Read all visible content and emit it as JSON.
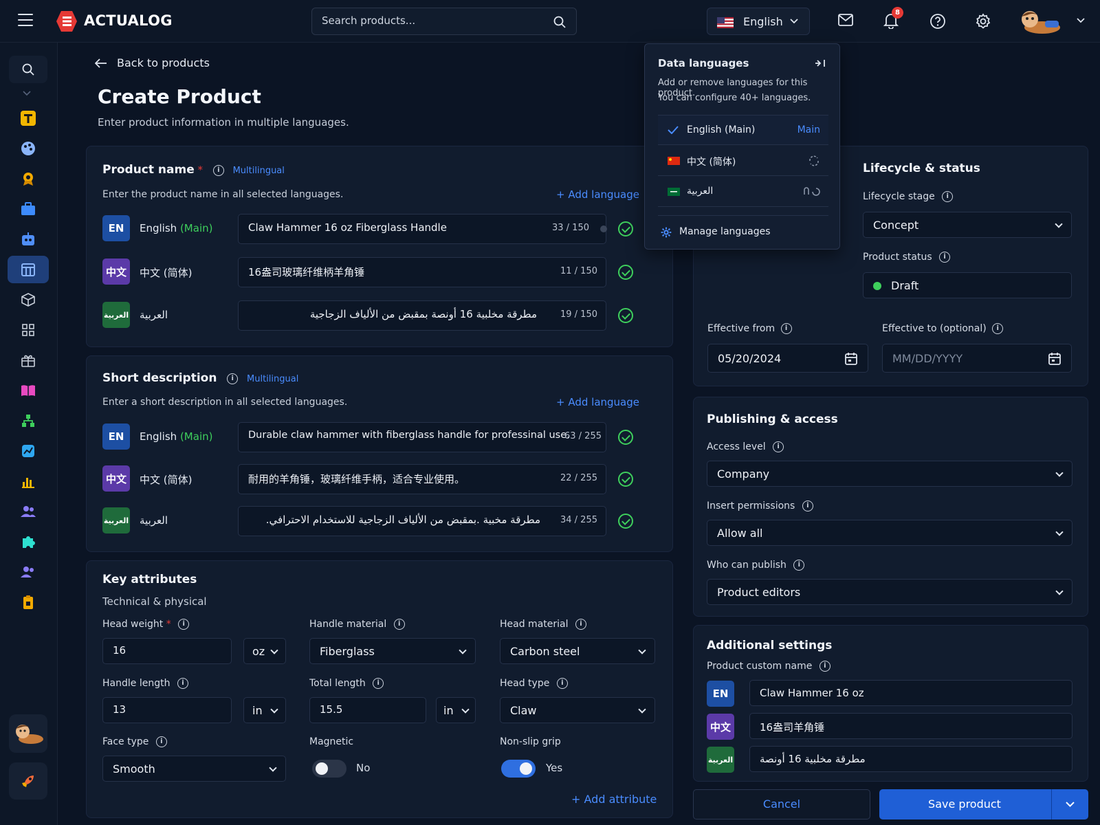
{
  "app": {
    "brand": "ACTUALOG"
  },
  "topbar": {
    "search_placeholder": "Search products...",
    "language": "English",
    "notification_count": "8"
  },
  "page": {
    "back_label": "Back to products",
    "title": "Create Product",
    "subtitle": "Enter product information in multiple languages."
  },
  "product_name": {
    "title": "Product name",
    "required_mark": "*",
    "multilingual": "Multilingual",
    "hint": "Enter the product name in all selected languages.",
    "add_language": "Add language",
    "rows": [
      {
        "tag": "EN",
        "name": "English",
        "main": "(Main)",
        "value": "Claw Hammer 16 oz Fiberglass Handle",
        "count": "33 / 150"
      },
      {
        "tag": "中文",
        "name": "中文 (简体)",
        "main": "",
        "value": "16盎司玻璃纤维柄羊角锤",
        "count": "11 / 150"
      },
      {
        "tag": "العربية",
        "name": "العربية",
        "main": "",
        "value": "مطرقة مخلبية 16 أونصة بمقبض من الألياف الزجاجية",
        "count": "19 / 150"
      }
    ]
  },
  "short_description": {
    "title": "Short description",
    "multilingual": "Multilingual",
    "hint": "Enter a short description in all selected languages.",
    "add_language": "Add language",
    "rows": [
      {
        "tag": "EN",
        "name": "English",
        "main": "(Main)",
        "value": "Durable claw hammer with fiberglass handle for professinal use.",
        "count": "63 / 255"
      },
      {
        "tag": "中文",
        "name": "中文 (简体)",
        "main": "",
        "value": "耐用的羊角锤，玻璃纤维手柄，适合专业使用。",
        "count": "22 / 255"
      },
      {
        "tag": "العربية",
        "name": "العربية",
        "main": "",
        "value": "مطرقة مخبية .بمقبض من الألياف الزجاجية للاستخدام الاحترافي.",
        "count": "34 / 255"
      }
    ]
  },
  "key_attributes": {
    "title": "Key attributes",
    "subtitle": "Technical & physical",
    "head_weight_label": "Head weight",
    "head_weight_value": "16",
    "head_weight_unit": "oz",
    "handle_material_label": "Handle material",
    "handle_material_value": "Fiberglass",
    "head_material_label": "Head material",
    "head_material_value": "Carbon steel",
    "handle_length_label": "Handle length",
    "handle_length_value": "13",
    "handle_length_unit": "in",
    "total_length_label": "Total length",
    "total_length_value": "15.5",
    "total_length_unit": "in",
    "head_type_label": "Head type",
    "head_type_value": "Claw",
    "face_type_label": "Face type",
    "face_type_value": "Smooth",
    "magnetic_label": "Magnetic",
    "magnetic_value": "No",
    "nonslip_label": "Non-slip grip",
    "nonslip_value": "Yes",
    "add_attribute": "Add attribute"
  },
  "data_languages": {
    "title": "Data languages",
    "desc_line1": "Add or remove languages for this product.",
    "desc_line2": "You can configure 40+ languages.",
    "items": [
      {
        "name": "English (Main)",
        "badge": "Main"
      },
      {
        "name": "中文 (简体)",
        "badge": ""
      },
      {
        "name": "العربية",
        "badge": ""
      }
    ],
    "manage": "Manage languages"
  },
  "lifecycle": {
    "title": "Lifecycle & status",
    "stage_label": "Lifecycle stage",
    "stage_value": "Concept",
    "status_label": "Product status",
    "status_value": "Draft",
    "status_color": "#3ecf5c",
    "from_label": "Effective from",
    "from_value": "05/20/2024",
    "to_label": "Effective to (optional)",
    "to_placeholder": "MM/DD/YYYY"
  },
  "publishing": {
    "title": "Publishing & access",
    "access_label": "Access level",
    "access_value": "Company",
    "insert_label": "Insert permissions",
    "insert_value": "Allow all",
    "publish_label": "Who can publish",
    "publish_value": "Product editors"
  },
  "additional": {
    "title": "Additional settings",
    "custom_name_label": "Product custom name",
    "rows": [
      {
        "tag": "EN",
        "value": "Claw Hammer 16 oz"
      },
      {
        "tag": "中文",
        "value": "16盎司羊角锤"
      },
      {
        "tag": "العربية",
        "value": "مطرقة مخلبية 16 أونصة"
      }
    ]
  },
  "footer": {
    "cancel": "Cancel",
    "save": "Save product"
  },
  "colors": {
    "accent": "#4a8cff",
    "primary": "#1f5fd6",
    "success": "#3ecf5c",
    "danger": "#e53935"
  }
}
